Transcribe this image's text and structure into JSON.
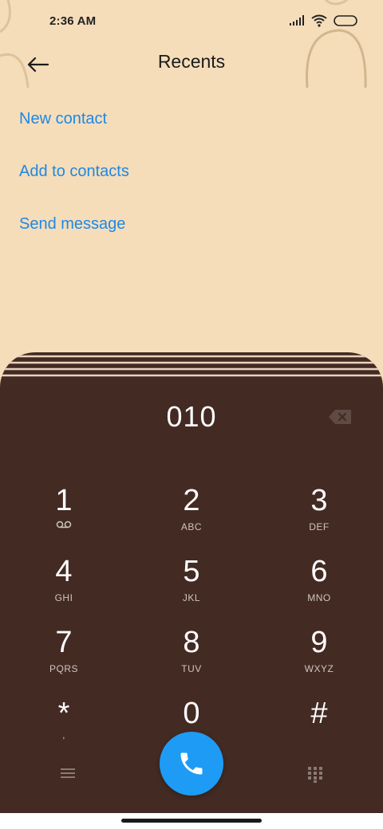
{
  "status_bar": {
    "time": "2:36 AM",
    "icons": [
      "signal-icon",
      "wifi-icon",
      "battery-icon"
    ]
  },
  "app_bar": {
    "back_icon": "back-arrow-icon",
    "title": "Recents"
  },
  "menu": {
    "items": [
      {
        "label": "New contact"
      },
      {
        "label": "Add to contacts"
      },
      {
        "label": "Send message"
      }
    ]
  },
  "dialer": {
    "number": "010",
    "keys": [
      {
        "digit": "1",
        "letters": ""
      },
      {
        "digit": "2",
        "letters": "ABC"
      },
      {
        "digit": "3",
        "letters": "DEF"
      },
      {
        "digit": "4",
        "letters": "GHI"
      },
      {
        "digit": "5",
        "letters": "JKL"
      },
      {
        "digit": "6",
        "letters": "MNO"
      },
      {
        "digit": "7",
        "letters": "PQRS"
      },
      {
        "digit": "8",
        "letters": "TUV"
      },
      {
        "digit": "9",
        "letters": "WXYZ"
      },
      {
        "digit": "*",
        "letters": ","
      },
      {
        "digit": "0",
        "letters": "+"
      },
      {
        "digit": "#",
        "letters": ""
      }
    ]
  },
  "colors": {
    "background": "#F5DDBA",
    "link": "#1E88E5",
    "dialer_bg": "#432A23",
    "call_button": "#1E9BF4"
  }
}
